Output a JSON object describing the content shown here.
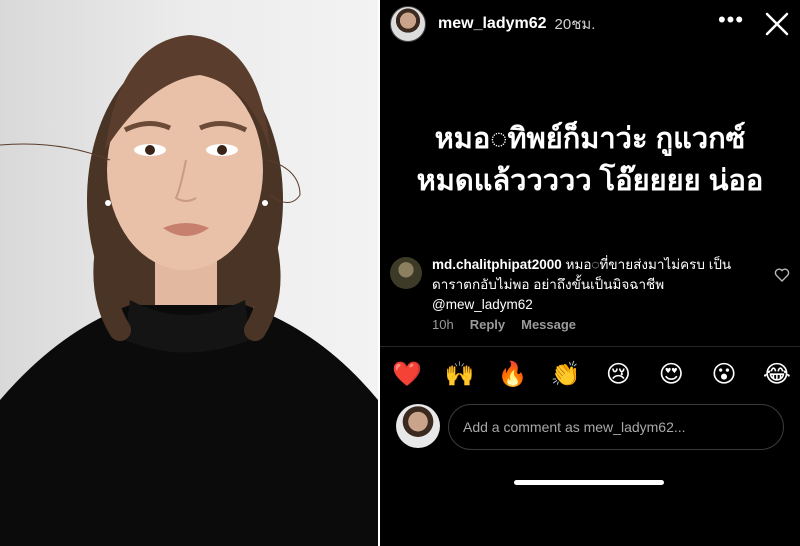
{
  "story": {
    "username": "mew_ladym62",
    "time": "20ชม.",
    "text_line1": "หมอ◌ทิพย์ก็มาว่ะ กูแวกซ์",
    "text_line2": "หมดแล้ววววว โอ๊ยยยย น่ออ"
  },
  "comment": {
    "username": "md.chalitphipat2000",
    "text": "หมอ◌ที่ขายส่งมาไม่ครบ เป็นดาราตกอับไม่พอ อย่าถึงขั้นเป็นมิจฉาชีพ @mew_ladym62",
    "age": "10h",
    "reply_label": "Reply",
    "message_label": "Message"
  },
  "reactions": [
    "❤️",
    "🙌",
    "🔥",
    "👏",
    "😢",
    "😍",
    "😮",
    "😂"
  ],
  "compose": {
    "placeholder": "Add a comment as mew_ladym62..."
  },
  "colors": {
    "background": "#000000",
    "text": "#ffffff",
    "muted": "#9a9a9a"
  },
  "icons": {
    "more": "more-horizontal-icon",
    "close": "close-icon",
    "like": "heart-outline-icon"
  }
}
